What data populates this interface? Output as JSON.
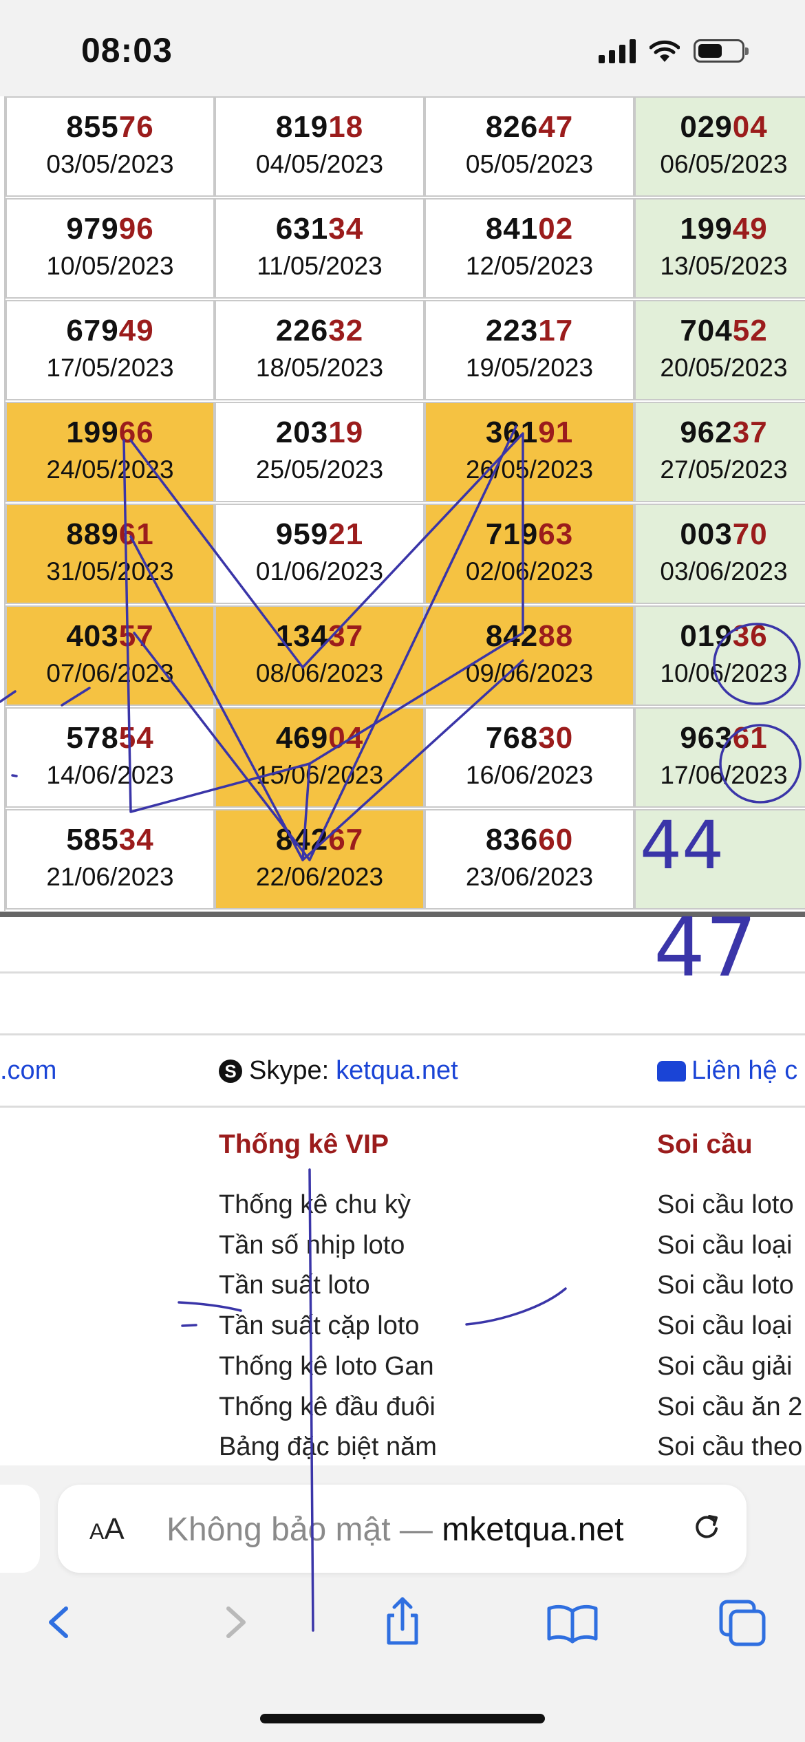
{
  "status_bar": {
    "time": "08:03"
  },
  "table": {
    "rows": [
      [
        {
          "head": "855",
          "tail": "76",
          "date": "03/05/2023",
          "style": "white"
        },
        {
          "head": "819",
          "tail": "18",
          "date": "04/05/2023",
          "style": "white"
        },
        {
          "head": "826",
          "tail": "47",
          "date": "05/05/2023",
          "style": "white"
        },
        {
          "head": "029",
          "tail": "04",
          "date": "06/05/2023",
          "style": "green"
        }
      ],
      [
        {
          "head": "979",
          "tail": "96",
          "date": "10/05/2023",
          "style": "white"
        },
        {
          "head": "631",
          "tail": "34",
          "date": "11/05/2023",
          "style": "white"
        },
        {
          "head": "841",
          "tail": "02",
          "date": "12/05/2023",
          "style": "white"
        },
        {
          "head": "199",
          "tail": "49",
          "date": "13/05/2023",
          "style": "green"
        }
      ],
      [
        {
          "head": "679",
          "tail": "49",
          "date": "17/05/2023",
          "style": "white"
        },
        {
          "head": "226",
          "tail": "32",
          "date": "18/05/2023",
          "style": "white"
        },
        {
          "head": "223",
          "tail": "17",
          "date": "19/05/2023",
          "style": "white"
        },
        {
          "head": "704",
          "tail": "52",
          "date": "20/05/2023",
          "style": "green"
        }
      ],
      [
        {
          "head": "199",
          "tail": "66",
          "date": "24/05/2023",
          "style": "hl"
        },
        {
          "head": "203",
          "tail": "19",
          "date": "25/05/2023",
          "style": "white"
        },
        {
          "head": "361",
          "tail": "91",
          "date": "26/05/2023",
          "style": "hl"
        },
        {
          "head": "962",
          "tail": "37",
          "date": "27/05/2023",
          "style": "green"
        }
      ],
      [
        {
          "head": "889",
          "tail": "61",
          "date": "31/05/2023",
          "style": "hl"
        },
        {
          "head": "959",
          "tail": "21",
          "date": "01/06/2023",
          "style": "white"
        },
        {
          "head": "719",
          "tail": "63",
          "date": "02/06/2023",
          "style": "hl"
        },
        {
          "head": "003",
          "tail": "70",
          "date": "03/06/2023",
          "style": "green"
        }
      ],
      [
        {
          "head": "403",
          "tail": "57",
          "date": "07/06/2023",
          "style": "hl"
        },
        {
          "head": "134",
          "tail": "37",
          "date": "08/06/2023",
          "style": "hl"
        },
        {
          "head": "842",
          "tail": "88",
          "date": "09/06/2023",
          "style": "hl"
        },
        {
          "head": "019",
          "tail": "36",
          "date": "10/06/2023",
          "style": "green"
        }
      ],
      [
        {
          "head": "578",
          "tail": "54",
          "date": "14/06/2023",
          "style": "white"
        },
        {
          "head": "469",
          "tail": "04",
          "date": "15/06/2023",
          "style": "hl"
        },
        {
          "head": "768",
          "tail": "30",
          "date": "16/06/2023",
          "style": "white"
        },
        {
          "head": "963",
          "tail": "61",
          "date": "17/06/2023",
          "style": "green"
        }
      ],
      [
        {
          "head": "585",
          "tail": "34",
          "date": "21/06/2023",
          "style": "white"
        },
        {
          "head": "842",
          "tail": "67",
          "date": "22/06/2023",
          "style": "hl"
        },
        {
          "head": "836",
          "tail": "60",
          "date": "23/06/2023",
          "style": "white"
        },
        {
          "head": "",
          "tail": "",
          "date": "",
          "style": "green"
        }
      ]
    ]
  },
  "handwritten_notes": [
    "44",
    "47"
  ],
  "contacts": {
    "left_text": ".com",
    "skype_label": "Skype:",
    "skype_link": "ketqua.net",
    "right_text": "Liên hệ c"
  },
  "footer": {
    "thong_ke": {
      "title": "Thống kê VIP",
      "items": [
        "Thống kê chu kỳ",
        "Tần số nhịp loto",
        "Tần suất loto",
        "Tần suất cặp loto",
        "Thống kê loto Gan",
        "Thống kê đầu đuôi",
        "Bảng đặc biệt năm"
      ]
    },
    "soi_cau": {
      "title": "Soi cầu",
      "items": [
        "Soi cầu loto",
        "Soi cầu loại",
        "Soi cầu loto",
        "Soi cầu loại",
        "Soi cầu giải",
        "Soi cầu ăn 2",
        "Soi cầu theo"
      ]
    }
  },
  "browser": {
    "aa_label": "AA",
    "url_prefix": "Không bảo mật — ",
    "url_host": "mketqua.net"
  },
  "colors": {
    "highlight": "#f5c242",
    "green_col": "#e2efd9",
    "tail_red": "#9b1c1c",
    "link_blue": "#1a44d6",
    "ink": "#3a35a8"
  }
}
